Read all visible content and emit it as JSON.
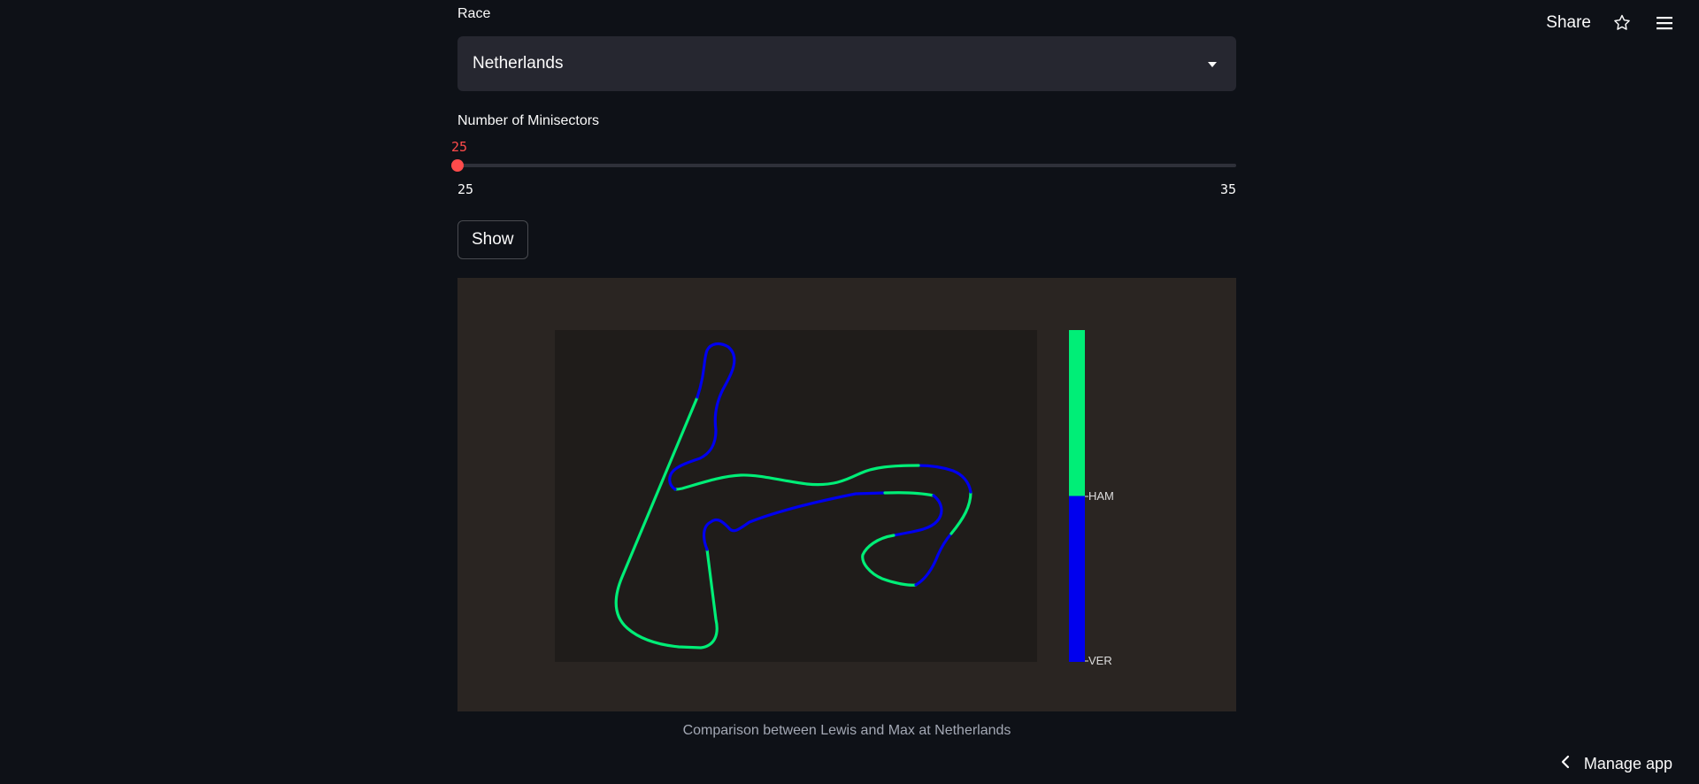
{
  "header": {
    "share_label": "Share",
    "star_icon": "star-icon",
    "menu_icon": "hamburger-menu-icon"
  },
  "race": {
    "label": "Race",
    "selected": "Netherlands"
  },
  "minisectors": {
    "label": "Number of Minisectors",
    "value": "25",
    "min": "25",
    "max": "35",
    "fraction": 0
  },
  "show_button": {
    "label": "Show"
  },
  "chart_data": {
    "type": "track-map",
    "legend": [
      "HAM",
      "VER"
    ],
    "colors": {
      "HAM": "#00ee77",
      "VER": "#0000ee"
    },
    "caption": "Comparison between Lewis and Max at Netherlands"
  },
  "footer": {
    "manage_label": "Manage app"
  }
}
